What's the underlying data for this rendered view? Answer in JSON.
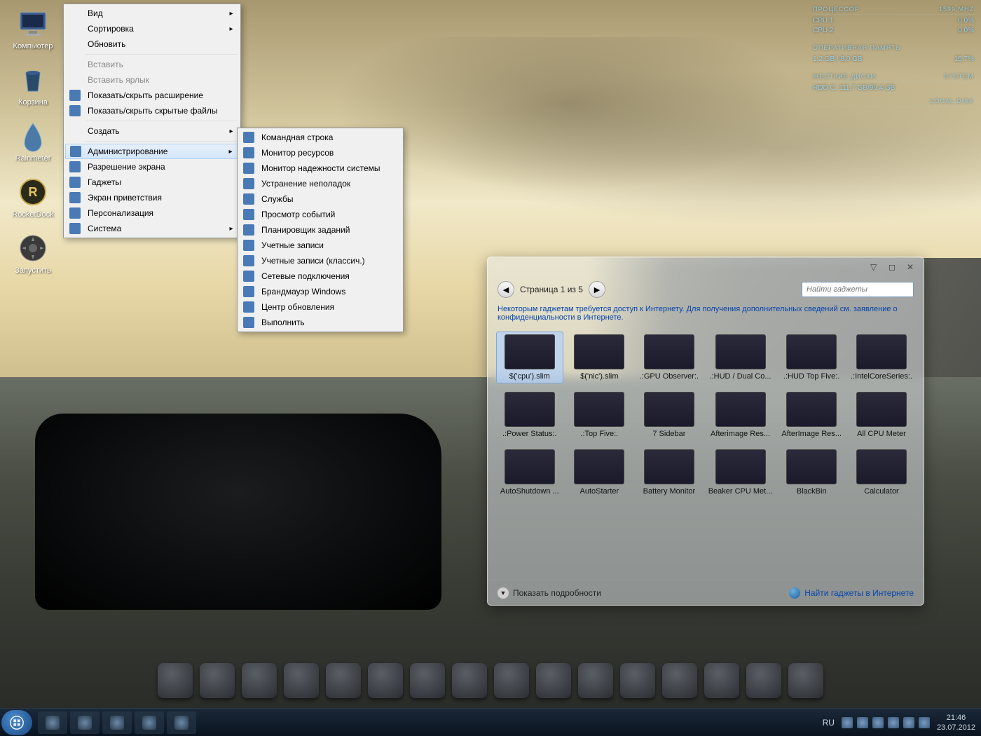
{
  "desktop_icons": [
    {
      "label": "Компьютер",
      "name": "computer"
    },
    {
      "label": "Корзина",
      "name": "recycle-bin"
    },
    {
      "label": "Rainmeter",
      "name": "rainmeter"
    },
    {
      "label": "RocketDock",
      "name": "rocketdock"
    },
    {
      "label": "Запустить",
      "name": "run"
    }
  ],
  "context_menu": {
    "items": [
      {
        "label": "Вид",
        "arrow": true
      },
      {
        "label": "Сортировка",
        "arrow": true
      },
      {
        "label": "Обновить"
      },
      {
        "sep": true
      },
      {
        "label": "Вставить",
        "disabled": true
      },
      {
        "label": "Вставить ярлык",
        "disabled": true
      },
      {
        "label": "Показать/скрыть расширение",
        "icon": true
      },
      {
        "label": "Показать/скрыть скрытые файлы",
        "icon": true
      },
      {
        "sep": true
      },
      {
        "label": "Создать",
        "arrow": true
      },
      {
        "sep": true
      },
      {
        "label": "Администрирование",
        "arrow": true,
        "icon": true,
        "highlighted": true
      },
      {
        "label": "Разрешение экрана",
        "icon": true
      },
      {
        "label": "Гаджеты",
        "icon": true
      },
      {
        "label": "Экран приветствия",
        "icon": true
      },
      {
        "label": "Персонализация",
        "icon": true
      },
      {
        "label": "Система",
        "arrow": true,
        "icon": true
      }
    ]
  },
  "submenu": {
    "items": [
      {
        "label": "Командная строка"
      },
      {
        "label": "Монитор ресурсов"
      },
      {
        "label": "Монитор надежности системы"
      },
      {
        "label": "Устранение неполадок"
      },
      {
        "label": "Службы"
      },
      {
        "label": "Просмотр событий"
      },
      {
        "label": "Планировщик заданий"
      },
      {
        "label": "Учетные записи"
      },
      {
        "label": "Учетные записи (классич.)"
      },
      {
        "label": "Сетевые подключения"
      },
      {
        "label": "Брандмауэр Windows"
      },
      {
        "label": "Центр обновления"
      },
      {
        "label": "Выполнить"
      }
    ]
  },
  "gadgets": {
    "page_label": "Страница 1 из 5",
    "search_placeholder": "Найти гаджеты",
    "notice": "Некоторым гаджетам требуется доступ к Интернету. Для получения дополнительных сведений см. заявление о конфиденциальности в Интернете.",
    "details_label": "Показать подробности",
    "online_label": "Найти гаджеты в Интернете",
    "items": [
      {
        "label": "$('cpu').slim",
        "selected": true
      },
      {
        "label": "$('nic').slim"
      },
      {
        "label": ".:GPU Observer:."
      },
      {
        "label": ".:HUD / Dual Co..."
      },
      {
        "label": ".:HUD Top Five:."
      },
      {
        "label": ".:IntelCoreSeries:."
      },
      {
        "label": ".:Power Status:."
      },
      {
        "label": ".:Top Five:."
      },
      {
        "label": "7 Sidebar"
      },
      {
        "label": "Afterimage Res..."
      },
      {
        "label": "AfterImage Res..."
      },
      {
        "label": "All CPU Meter"
      },
      {
        "label": "AutoShutdown ..."
      },
      {
        "label": "AutoStarter"
      },
      {
        "label": "Battery Monitor"
      },
      {
        "label": "Beaker CPU Met..."
      },
      {
        "label": "BlackBin"
      },
      {
        "label": "Calculator"
      }
    ]
  },
  "hud": {
    "cpu_title": "ПРОЦЕССОР",
    "cpu_freq": "1599 MHZ",
    "cpu1_label": "CPU 1",
    "cpu1_val": "0.0%",
    "cpu2_label": "CPU 2",
    "cpu2_val": "0.0%",
    "ram_title": "ОПЕРАТИВНАЯ ПАМЯТЬ",
    "ram_val": "1.2 GB / 8.0 GB",
    "ram_pct": "15.7%",
    "hdd_title": "ЖЕСТКИЕ ДИСКИ",
    "hdd_sys": "SYSTEM",
    "hdd_row": "HDD C: 111.7 GB/99.4 GB",
    "local_title": "LOCAL DISK"
  },
  "taskbar": {
    "lang": "RU",
    "time": "21:46",
    "date": "23.07.2012"
  },
  "dock_count": 16,
  "taskbar_items": 5,
  "tray_icons": 6
}
